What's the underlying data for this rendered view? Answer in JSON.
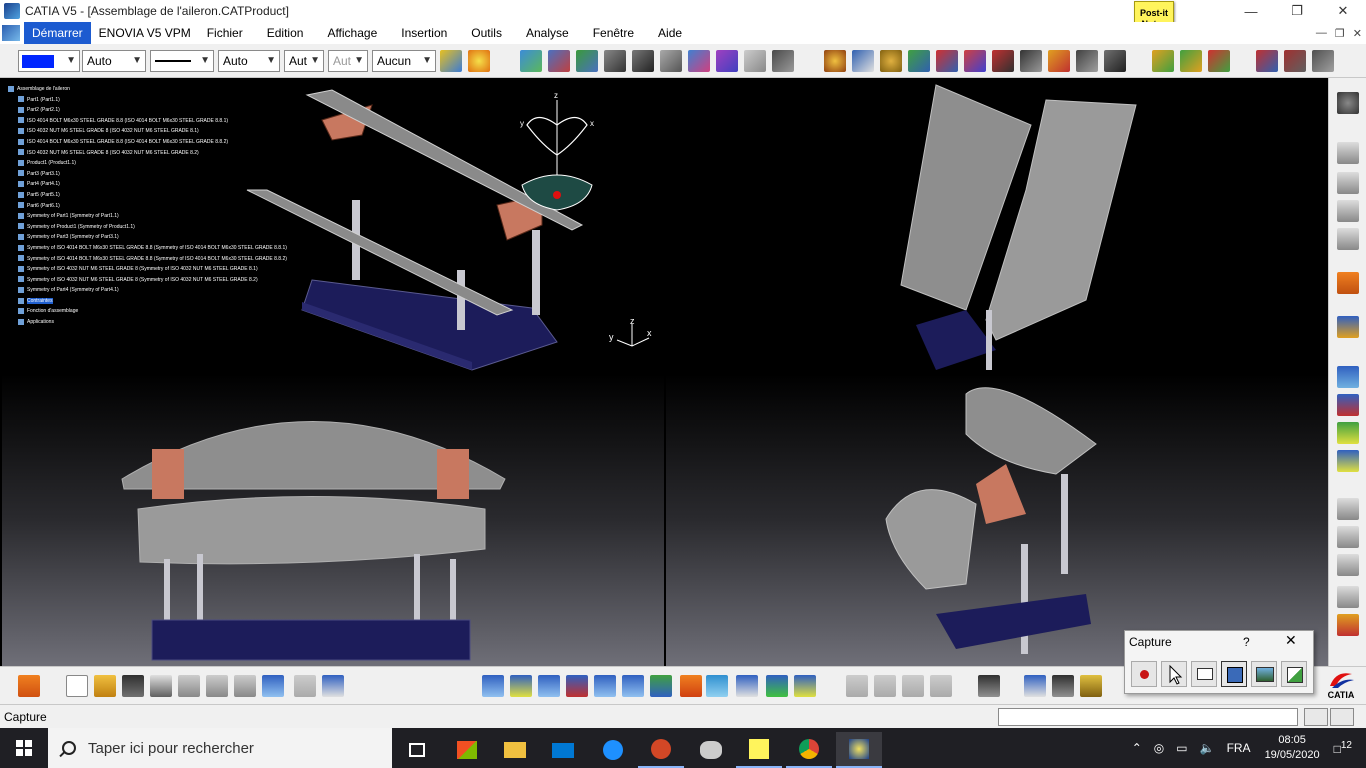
{
  "window": {
    "title": "CATIA V5 - [Assemblage de l'aileron.CATProduct]"
  },
  "menu": {
    "items": [
      "Démarrer",
      "ENOVIA V5 VPM",
      "Fichier",
      "Edition",
      "Affichage",
      "Insertion",
      "Outils",
      "Analyse",
      "Fenêtre",
      "Aide"
    ]
  },
  "postit": {
    "line1": "Post-it",
    "line2": "Notes"
  },
  "toolbar": {
    "linetype": "Auto",
    "thickness": "Auto",
    "combo3": "Aut",
    "combo4": "Aut",
    "layer": "Aucun"
  },
  "tree": {
    "nodes": [
      "Assemblage de l'aileron",
      "Part1 (Part1.1)",
      "Part2 (Part2.1)",
      "ISO 4014 BOLT M6x30 STEEL GRADE 8.8 (ISO 4014 BOLT M6x30 STEEL GRADE 8.8.1)",
      "ISO 4032 NUT M6 STEEL GRADE 8 (ISO 4032 NUT M6 STEEL GRADE 8.1)",
      "ISO 4014 BOLT M6x30 STEEL GRADE 8.8 (ISO 4014 BOLT M6x30 STEEL GRADE 8.8.2)",
      "ISO 4032 NUT M6 STEEL GRADE 8 (ISO 4032 NUT M6 STEEL GRADE 8.2)",
      "Product1 (Product1.1)",
      "Part3 (Part3.1)",
      "Part4 (Part4.1)",
      "Part5 (Part5.1)",
      "Part6 (Part6.1)",
      "Symmetry of Part1 (Symmetry of Part1.1)",
      "Symmetry of Product1 (Symmetry of Product1.1)",
      "Symmetry of Part3 (Symmetry of Part3.1)",
      "Symmetry of ISO 4014 BOLT M6x30 STEEL GRADE 8.8 (Symmetry of ISO 4014 BOLT M6x30 STEEL GRADE 8.8.1)",
      "Symmetry of ISO 4014 BOLT M6x30 STEEL GRADE 8.8 (Symmetry of ISO 4014 BOLT M6x30 STEEL GRADE 8.8.2)",
      "Symmetry of ISO 4032 NUT M6 STEEL GRADE 8 (Symmetry of ISO 4032 NUT M6 STEEL GRADE 8.1)",
      "Symmetry of ISO 4032 NUT M6 STEEL GRADE 8 (Symmetry of ISO 4032 NUT M6 STEEL GRADE 8.2)",
      "Symmetry of Part4 (Symmetry of Part4.1)",
      "Contraintes",
      "Fonction d'assemblage",
      "Applications"
    ],
    "selected_index": 20
  },
  "compass": {
    "z": "z",
    "x": "x",
    "y": "y"
  },
  "axis": {
    "x": "x",
    "y": "y",
    "z": "z"
  },
  "status": {
    "text": "Capture"
  },
  "capture": {
    "title": "Capture",
    "help": "?",
    "close": "✕"
  },
  "catia_logo": "CATIA",
  "taskbar": {
    "search_placeholder": "Taper ici pour rechercher",
    "lang": "FRA",
    "time": "08:05",
    "date": "19/05/2020",
    "notifications": "12"
  },
  "colors": {
    "menu_active": "#1c5bd0",
    "viewport": "#000000",
    "color_swatch": "#0026ff"
  }
}
